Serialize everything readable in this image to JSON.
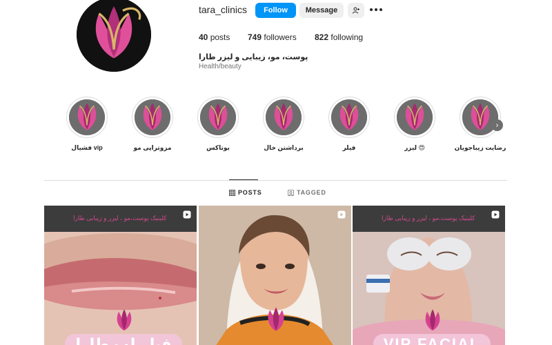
{
  "profile": {
    "username": "tara_clinics",
    "follow_label": "Follow",
    "message_label": "Message",
    "posts_count": "40",
    "posts_label": "posts",
    "followers_count": "749",
    "followers_label": "followers",
    "following_count": "822",
    "following_label": "following",
    "bio": "پوست، مو، زیبایی و لیزر طارا",
    "category": "Health/beauty"
  },
  "highlights": [
    {
      "label": "فشیال vip"
    },
    {
      "label": "مزوتراپی مو"
    },
    {
      "label": "بوتاکس"
    },
    {
      "label": "برداشتن خال"
    },
    {
      "label": "فیلر"
    },
    {
      "label": "لیزر 😍"
    },
    {
      "label": "رضایت زیباجویان"
    }
  ],
  "tabs": {
    "posts": "POSTS",
    "tagged": "TAGGED"
  },
  "posts": [
    {
      "banner": "کلینیک پوست،مو ، لیزر و زیبایی طارا",
      "caption": "فیلر لب طارا"
    },
    {
      "banner": "",
      "caption": ""
    },
    {
      "banner": "کلینیک پوست،مو ، لیزر و زیبایی طارا",
      "caption": "VIP FACIAL"
    }
  ],
  "colors": {
    "follow_button": "#0095f6",
    "brand_pink": "#d14a8d",
    "avatar_bg": "#111111"
  },
  "icons": {
    "add_user": "add-user-icon",
    "more": "more-dots-icon",
    "grid": "grid-icon",
    "tagged": "tagged-icon",
    "reel": "reel-icon",
    "next": "chevron-right-icon"
  }
}
